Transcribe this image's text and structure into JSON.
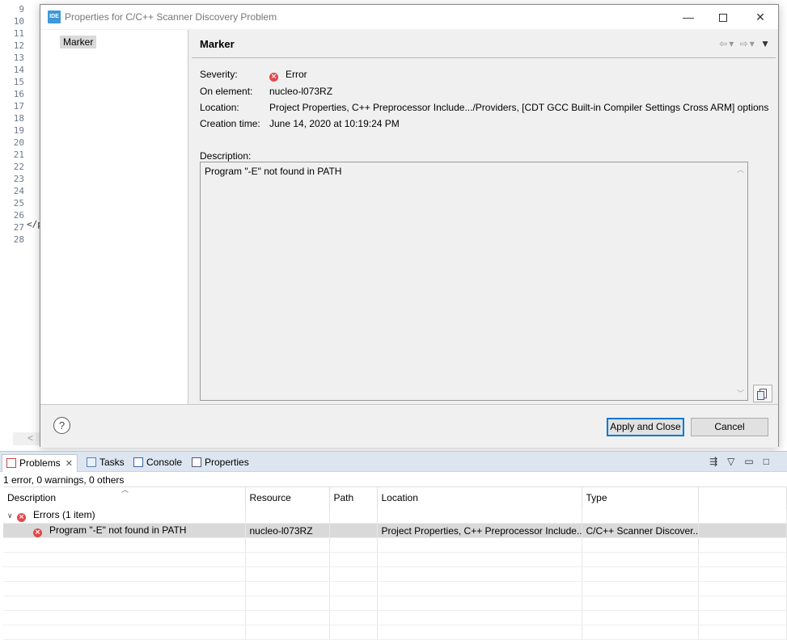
{
  "editor": {
    "line_numbers": [
      "9",
      "10",
      "11",
      "12",
      "13",
      "14",
      "15",
      "16",
      "17",
      "18",
      "19",
      "20",
      "21",
      "22",
      "23",
      "24",
      "25",
      "26",
      "27",
      "28"
    ],
    "fragment": "</p",
    "scroll_left_arrow": "<"
  },
  "dialog": {
    "app_icon_text": "IDE",
    "title": "Properties for C/C++ Scanner Discovery Problem",
    "window_controls": {
      "minimize": "—",
      "close": "✕"
    },
    "sidebar": {
      "items": [
        {
          "label": "Marker"
        }
      ]
    },
    "page_heading": "Marker",
    "properties": {
      "severity": {
        "label": "Severity:",
        "value": "Error",
        "icon": "error-icon"
      },
      "on_element": {
        "label": "On element:",
        "value": "nucleo-l073RZ"
      },
      "location": {
        "label": "Location:",
        "value": "Project Properties, C++ Preprocessor Include.../Providers, [CDT GCC Built-in Compiler Settings Cross ARM] options"
      },
      "creation_time": {
        "label": "Creation time:",
        "value": "June 14, 2020 at 10:19:24 PM"
      }
    },
    "description": {
      "label": "Description:",
      "text": "Program \"-E\" not found in PATH"
    },
    "buttons": {
      "help": "?",
      "apply_close": "Apply and Close",
      "cancel": "Cancel"
    }
  },
  "problems_view": {
    "tabs": [
      {
        "label": "Problems",
        "active": true
      },
      {
        "label": "Tasks",
        "active": false
      },
      {
        "label": "Console",
        "active": false
      },
      {
        "label": "Properties",
        "active": false
      }
    ],
    "summary": "1 error, 0 warnings, 0 others",
    "columns": [
      "Description",
      "Resource",
      "Path",
      "Location",
      "Type"
    ],
    "group": {
      "label": "Errors (1 item)"
    },
    "rows": [
      {
        "description": "Program \"-E\" not found in PATH",
        "resource": "nucleo-l073RZ",
        "path": "",
        "location": "Project Properties, C++ Preprocessor Include...",
        "type": "C/C++ Scanner Discover..."
      }
    ]
  },
  "colors": {
    "error": "#e0494b",
    "focus": "#0078d7",
    "tab_strip": "#dde5f0"
  }
}
